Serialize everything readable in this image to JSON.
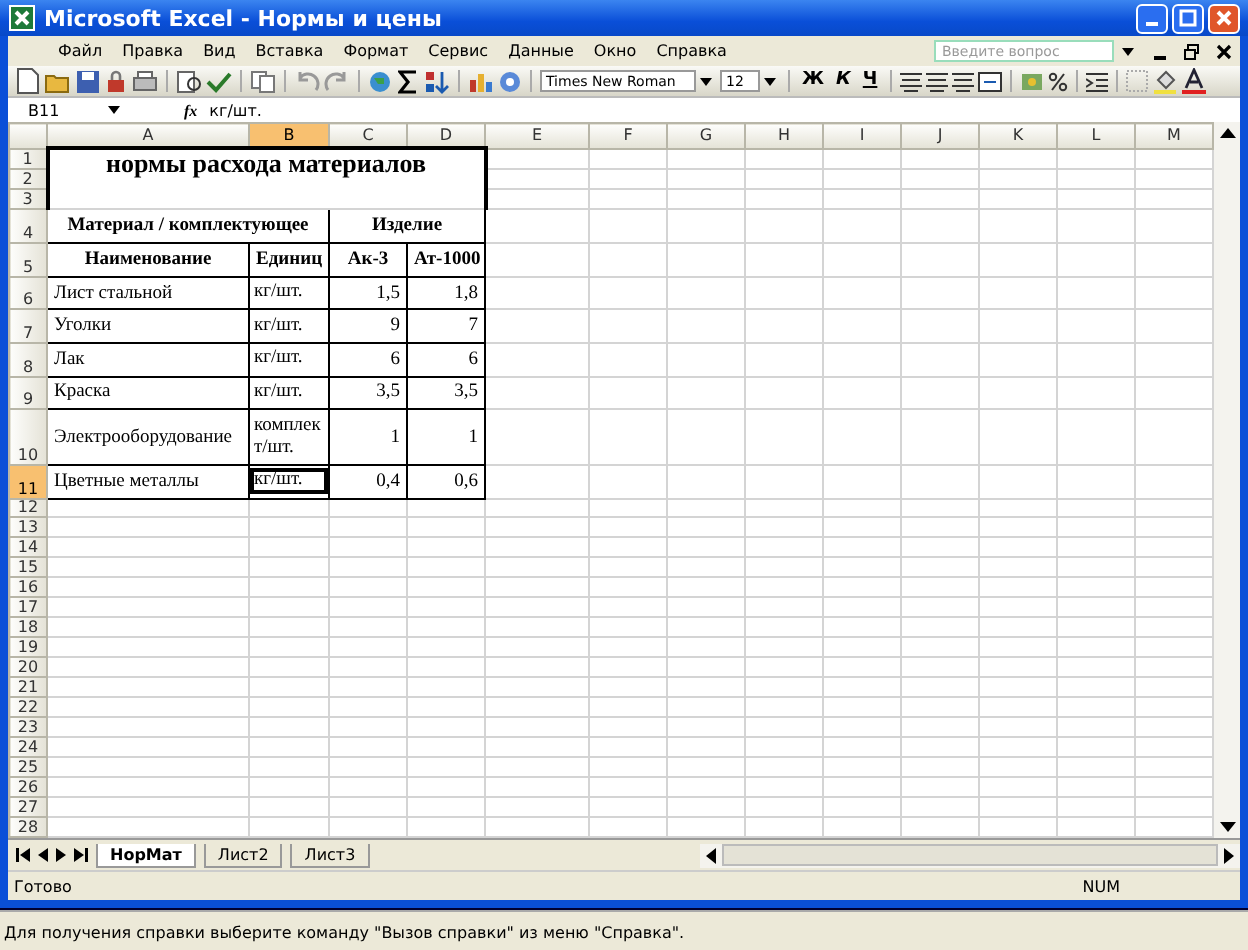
{
  "window": {
    "title": "Microsoft Excel - Нормы и цены"
  },
  "menu": [
    {
      "label": "Файл"
    },
    {
      "label": "Правка"
    },
    {
      "label": "Вид"
    },
    {
      "label": "Вставка"
    },
    {
      "label": "Формат"
    },
    {
      "label": "Сервис"
    },
    {
      "label": "Данные"
    },
    {
      "label": "Окно"
    },
    {
      "label": "Справка"
    }
  ],
  "help_search": {
    "placeholder": "Введите вопрос"
  },
  "toolbar": {
    "font": "Times New Roman",
    "size": "12",
    "format_buttons": [
      {
        "label": "Ж",
        "kind": "bold"
      },
      {
        "label": "К",
        "kind": "italic"
      },
      {
        "label": "Ч",
        "kind": "underline"
      }
    ]
  },
  "formula_bar": {
    "name_box": "B11",
    "fx": "fx",
    "value": "кг/шт."
  },
  "columns": [
    {
      "label": "A",
      "selected": false
    },
    {
      "label": "B",
      "selected": true
    },
    {
      "label": "C",
      "selected": false
    },
    {
      "label": "D",
      "selected": false
    },
    {
      "label": "E",
      "selected": false
    },
    {
      "label": "F",
      "selected": false
    },
    {
      "label": "G",
      "selected": false
    },
    {
      "label": "H",
      "selected": false
    },
    {
      "label": "I",
      "selected": false
    },
    {
      "label": "J",
      "selected": false
    },
    {
      "label": "K",
      "selected": false
    },
    {
      "label": "L",
      "selected": false
    },
    {
      "label": "M",
      "selected": false
    }
  ],
  "rows": [
    {
      "label": "1",
      "selected": false
    },
    {
      "label": "2",
      "selected": false
    },
    {
      "label": "3",
      "selected": false
    },
    {
      "label": "4",
      "selected": false
    },
    {
      "label": "5",
      "selected": false
    },
    {
      "label": "6",
      "selected": false
    },
    {
      "label": "7",
      "selected": false
    },
    {
      "label": "8",
      "selected": false
    },
    {
      "label": "9",
      "selected": false
    },
    {
      "label": "10",
      "selected": false
    },
    {
      "label": "11",
      "selected": true
    },
    {
      "label": "12",
      "selected": false
    },
    {
      "label": "13",
      "selected": false
    },
    {
      "label": "14",
      "selected": false
    },
    {
      "label": "15",
      "selected": false
    },
    {
      "label": "16",
      "selected": false
    },
    {
      "label": "17",
      "selected": false
    },
    {
      "label": "18",
      "selected": false
    },
    {
      "label": "19",
      "selected": false
    },
    {
      "label": "20",
      "selected": false
    },
    {
      "label": "21",
      "selected": false
    },
    {
      "label": "22",
      "selected": false
    },
    {
      "label": "23",
      "selected": false
    },
    {
      "label": "24",
      "selected": false
    },
    {
      "label": "25",
      "selected": false
    },
    {
      "label": "26",
      "selected": false
    },
    {
      "label": "27",
      "selected": false
    },
    {
      "label": "28",
      "selected": false
    }
  ],
  "sheet": {
    "title": "нормы расхода материалов",
    "group_headers": [
      "Материал / комплектующее",
      "Изделие"
    ],
    "headers": [
      "Наименование",
      "Единиц",
      "Ак-3",
      "Ат-1000"
    ],
    "items": [
      {
        "name": "Лист стальной",
        "unit": "кг/шт.",
        "ak3": "1,5",
        "at1000": "1,8",
        "unit_selected": false
      },
      {
        "name": "Уголки",
        "unit": "кг/шт.",
        "ak3": "9",
        "at1000": "7",
        "unit_selected": false
      },
      {
        "name": "Лак",
        "unit": "кг/шт.",
        "ak3": "6",
        "at1000": "6",
        "unit_selected": false
      },
      {
        "name": "Краска",
        "unit": "кг/шт.",
        "ak3": "3,5",
        "at1000": "3,5",
        "unit_selected": false
      },
      {
        "name": "Электрооборудование",
        "unit": "комплект/шт.",
        "ak3": "1",
        "at1000": "1",
        "unit_selected": false
      },
      {
        "name": "Цветные металлы",
        "unit": "кг/шт.",
        "ak3": "0,4",
        "at1000": "0,6",
        "unit_selected": true
      }
    ]
  },
  "sheet_tabs": [
    {
      "label": "НорМат",
      "selected": true
    },
    {
      "label": "Лист2",
      "selected": false
    },
    {
      "label": "Лист3",
      "selected": false
    }
  ],
  "status_bar": {
    "text": "Готово",
    "indicator": "NUM"
  },
  "help_bar": "Для получения справки выберите команду \"Вызов справки\" из меню \"Справка\"."
}
